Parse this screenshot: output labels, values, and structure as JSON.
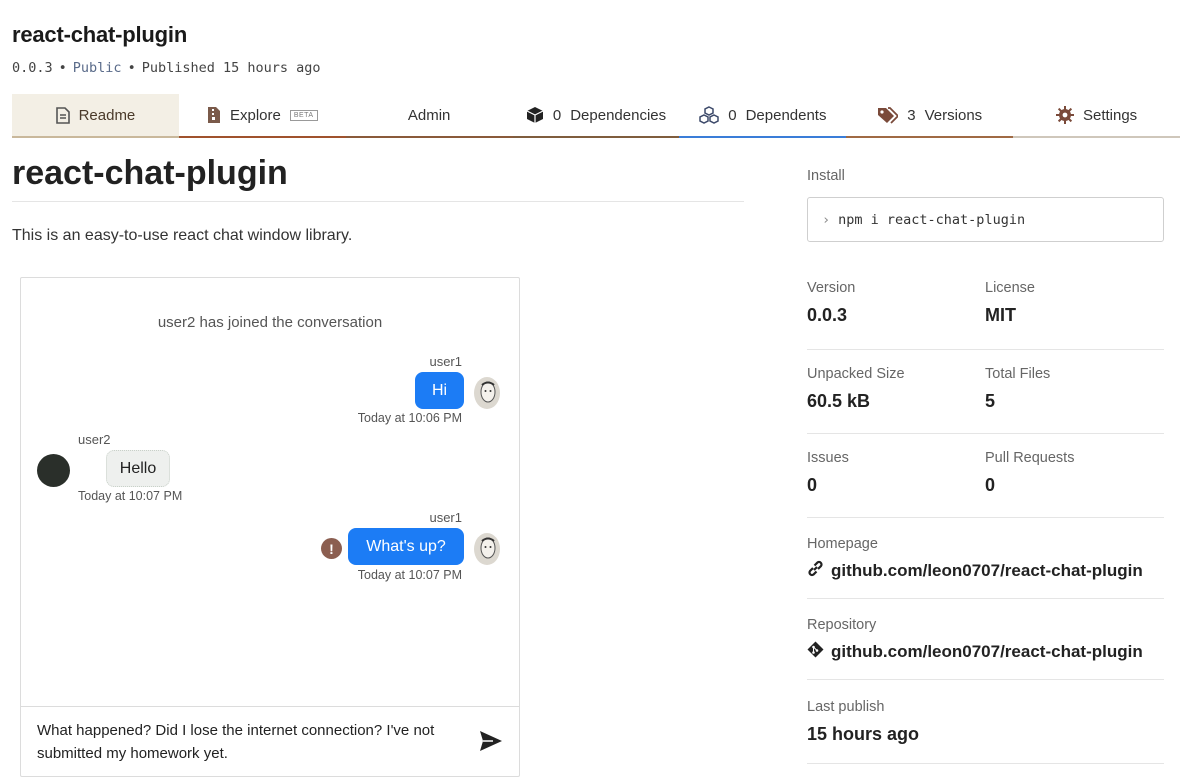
{
  "package": {
    "name": "react-chat-plugin",
    "version": "0.0.3",
    "visibility": "Public",
    "published": "Published 15 hours ago"
  },
  "tabs": {
    "readme": "Readme",
    "explore": "Explore",
    "explore_badge": "BETA",
    "admin": "Admin",
    "dependencies_count": "0",
    "dependencies": "Dependencies",
    "dependents_count": "0",
    "dependents": "Dependents",
    "versions_count": "3",
    "versions": "Versions",
    "settings": "Settings"
  },
  "readme": {
    "title": "react-chat-plugin",
    "description": "This is an easy-to-use react chat window library."
  },
  "chat": {
    "system_message": "user2 has joined the conversation",
    "messages": [
      {
        "user": "user1",
        "text": "Hi",
        "time": "Today at 10:06 PM"
      },
      {
        "user": "user2",
        "text": "Hello",
        "time": "Today at 10:07 PM"
      },
      {
        "user": "user1",
        "text": "What's up?",
        "time": "Today at 10:07 PM"
      }
    ],
    "input_text": "What happened? Did I lose the internet connection? I've not submitted my homework yet."
  },
  "sidebar": {
    "install_label": "Install",
    "install_command": "npm i react-chat-plugin",
    "version_label": "Version",
    "version": "0.0.3",
    "license_label": "License",
    "license": "MIT",
    "unpacked_size_label": "Unpacked Size",
    "unpacked_size": "60.5 kB",
    "total_files_label": "Total Files",
    "total_files": "5",
    "issues_label": "Issues",
    "issues": "0",
    "pull_requests_label": "Pull Requests",
    "pull_requests": "0",
    "homepage_label": "Homepage",
    "homepage": "github.com/leon0707/react-chat-plugin",
    "repository_label": "Repository",
    "repository": "github.com/leon0707/react-chat-plugin",
    "last_publish_label": "Last publish",
    "last_publish": "15 hours ago"
  },
  "colors": {
    "outgoing_bubble": "#1c7cf5",
    "readme_tab_bg": "#f3efe5",
    "error_icon": "#8b5e50"
  }
}
